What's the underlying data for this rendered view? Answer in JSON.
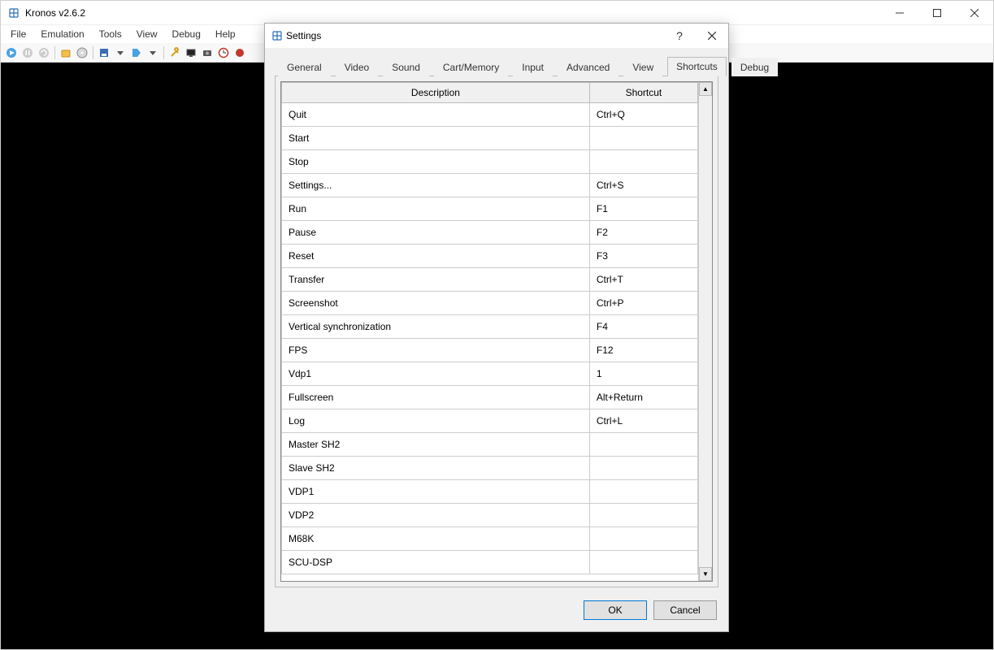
{
  "app": {
    "title": "Kronos v2.6.2"
  },
  "menubar": [
    "File",
    "Emulation",
    "Tools",
    "View",
    "Debug",
    "Help"
  ],
  "dialog": {
    "title": "Settings",
    "tabs": [
      "General",
      "Video",
      "Sound",
      "Cart/Memory",
      "Input",
      "Advanced",
      "View",
      "Shortcuts",
      "Debug"
    ],
    "active_tab": "Shortcuts",
    "headers": {
      "description": "Description",
      "shortcut": "Shortcut"
    },
    "rows": [
      {
        "desc": "Quit",
        "shortcut": "Ctrl+Q"
      },
      {
        "desc": "Start",
        "shortcut": ""
      },
      {
        "desc": "Stop",
        "shortcut": ""
      },
      {
        "desc": "Settings...",
        "shortcut": "Ctrl+S"
      },
      {
        "desc": "Run",
        "shortcut": "F1"
      },
      {
        "desc": "Pause",
        "shortcut": "F2"
      },
      {
        "desc": "Reset",
        "shortcut": "F3"
      },
      {
        "desc": "Transfer",
        "shortcut": "Ctrl+T"
      },
      {
        "desc": "Screenshot",
        "shortcut": "Ctrl+P"
      },
      {
        "desc": "Vertical synchronization",
        "shortcut": "F4"
      },
      {
        "desc": "FPS",
        "shortcut": "F12"
      },
      {
        "desc": "Vdp1",
        "shortcut": "1"
      },
      {
        "desc": "Fullscreen",
        "shortcut": "Alt+Return"
      },
      {
        "desc": "Log",
        "shortcut": "Ctrl+L"
      },
      {
        "desc": "Master SH2",
        "shortcut": ""
      },
      {
        "desc": "Slave SH2",
        "shortcut": ""
      },
      {
        "desc": "VDP1",
        "shortcut": ""
      },
      {
        "desc": "VDP2",
        "shortcut": ""
      },
      {
        "desc": "M68K",
        "shortcut": ""
      },
      {
        "desc": "SCU-DSP",
        "shortcut": ""
      }
    ],
    "buttons": {
      "ok": "OK",
      "cancel": "Cancel"
    }
  }
}
